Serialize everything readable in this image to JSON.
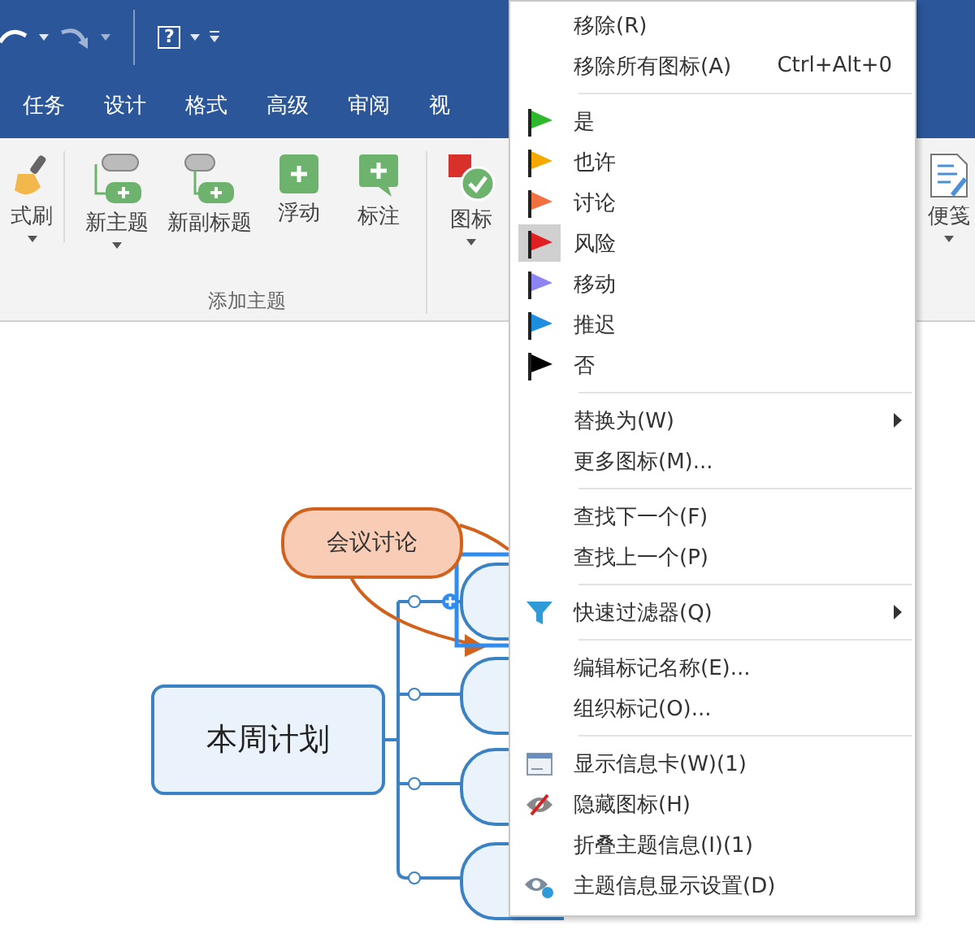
{
  "quick_access": {
    "help": "?"
  },
  "tabs": [
    {
      "label": "任务"
    },
    {
      "label": "设计"
    },
    {
      "label": "格式"
    },
    {
      "label": "高级"
    },
    {
      "label": "审阅"
    },
    {
      "label": "视"
    }
  ],
  "ribbon": {
    "buttons": [
      {
        "label": "式刷",
        "kind": "brush",
        "dropdown": true
      },
      {
        "label": "新主题",
        "kind": "topic",
        "dropdown": true
      },
      {
        "label": "新副标题",
        "kind": "subtopic",
        "dropdown": false
      },
      {
        "label": "浮动",
        "kind": "float",
        "dropdown": false
      },
      {
        "label": "标注",
        "kind": "callout",
        "dropdown": false
      },
      {
        "label": "图标",
        "kind": "marker",
        "dropdown": true
      },
      {
        "label": "便笺",
        "kind": "note",
        "dropdown": true
      }
    ],
    "group_label": "添加主题"
  },
  "map": {
    "central": "本周计划",
    "callout": "会议讨论"
  },
  "menu": [
    {
      "kind": "item",
      "label": "移除(R)"
    },
    {
      "kind": "item",
      "label": "移除所有图标(A)",
      "shortcut": "Ctrl+Alt+0"
    },
    {
      "kind": "separator"
    },
    {
      "kind": "flag",
      "label": "是",
      "color": "#2eb82e",
      "selected": false
    },
    {
      "kind": "flag",
      "label": "也许",
      "color": "#f5a800",
      "selected": false
    },
    {
      "kind": "flag",
      "label": "讨论",
      "color": "#f07040",
      "selected": false
    },
    {
      "kind": "flag",
      "label": "风险",
      "color": "#e02020",
      "selected": true
    },
    {
      "kind": "flag",
      "label": "移动",
      "color": "#8c84f0",
      "selected": false
    },
    {
      "kind": "flag",
      "label": "推迟",
      "color": "#1e8fe0",
      "selected": false
    },
    {
      "kind": "flag",
      "label": "否",
      "color": "#000000",
      "selected": false
    },
    {
      "kind": "separator"
    },
    {
      "kind": "item",
      "label": "替换为(W)",
      "submenu": true
    },
    {
      "kind": "item",
      "label": "更多图标(M)...",
      "submenu": false
    },
    {
      "kind": "separator"
    },
    {
      "kind": "item",
      "label": "查找下一个(F)"
    },
    {
      "kind": "item",
      "label": "查找上一个(P)"
    },
    {
      "kind": "separator"
    },
    {
      "kind": "filter",
      "label": "快速过滤器(Q)",
      "submenu": true
    },
    {
      "kind": "separator"
    },
    {
      "kind": "item",
      "label": "编辑标记名称(E)..."
    },
    {
      "kind": "item",
      "label": "组织标记(O)..."
    },
    {
      "kind": "separator"
    },
    {
      "kind": "card",
      "label": "显示信息卡(W)(1)"
    },
    {
      "kind": "hide",
      "label": "隐藏图标(H)"
    },
    {
      "kind": "item",
      "label": "折叠主题信息(I)(1)"
    },
    {
      "kind": "settings",
      "label": "主题信息显示设置(D)"
    }
  ]
}
